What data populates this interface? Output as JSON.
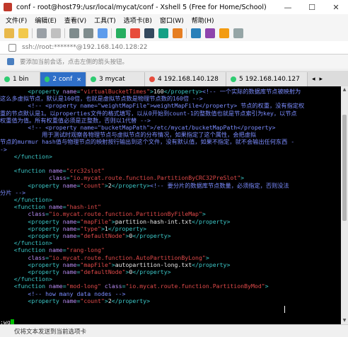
{
  "window": {
    "title": "conf - root@host79:/usr/local/mycat/conf - Xshell 5 (Free for Home/School)",
    "min": "—",
    "max": "☐",
    "close": "✕"
  },
  "menu": [
    "文件(F)",
    "编辑(E)",
    "查看(V)",
    "工具(T)",
    "选项卡(B)",
    "窗口(W)",
    "帮助(H)"
  ],
  "address": "ssh://root:*******@192.168.140.128:22",
  "hint": "要添加当前会话，点击左侧的箭头按钮。",
  "tabs": [
    {
      "label": "1 bin",
      "dot": "#2ecc71"
    },
    {
      "label": "2 conf",
      "dot": "#2ecc71"
    },
    {
      "label": "3 mycat",
      "dot": "#2ecc71"
    },
    {
      "label": "4 192.168.140.128",
      "dot": "#e74c3c"
    },
    {
      "label": "5 192.168.140.127",
      "dot": "#2ecc71"
    }
  ],
  "terminal_lines": [
    [
      [
        "tg",
        "        <"
      ],
      [
        "tg",
        "property "
      ],
      [
        "at",
        "name"
      ],
      [
        "tg",
        "="
      ],
      [
        "st",
        "\"virtualBucketTimes\""
      ],
      [
        "tg",
        ">"
      ],
      [
        "tx",
        "160"
      ],
      [
        "tg",
        "</property>"
      ],
      [
        "cm",
        "<!-- 一个实际的数据库节点被映射为"
      ]
    ],
    [
      [
        "cm",
        "这么多虚拟节点，默认是160倍，也就是虚拟节点数是物理节点数的160倍 -->"
      ]
    ],
    [
      [
        "cm",
        "        <!-- <property name=\"weightMapFile\">weightMapFile</property> 节点的权重，没有指定权"
      ]
    ],
    [
      [
        "cm",
        "重的节点默认是1。以properties文件的格式填写，以从0开始到count-1的整数值也就是节点索引为key，以节点"
      ]
    ],
    [
      [
        "cm",
        "权重值为值。所有权重值必须是正整数，否则以1代替 -->"
      ]
    ],
    [
      [
        "cm",
        "        <!-- <property name=\"bucketMapPath\">/etc/mycat/bucketMapPath</property>"
      ]
    ],
    [
      [
        "cm",
        "            用于测试时观察各物理节点与虚拟节点的分布情况，如果指定了这个属性，会把虚拟"
      ]
    ],
    [
      [
        "cm",
        "节点的murmur hash值与物理节点的映射按行输出到这个文件，没有默认值，如果不指定，就不会输出任何东西 -"
      ]
    ],
    [
      [
        "cm",
        "->"
      ]
    ],
    [
      [
        "tg",
        "    </function>"
      ]
    ],
    [
      [
        "tx",
        ""
      ]
    ],
    [
      [
        "tg",
        "    <function "
      ],
      [
        "at",
        "name"
      ],
      [
        "tg",
        "="
      ],
      [
        "st",
        "\"crc32slot\""
      ]
    ],
    [
      [
        "tg",
        "              "
      ],
      [
        "at",
        "class"
      ],
      [
        "tg",
        "="
      ],
      [
        "st",
        "\"io.mycat.route.function.PartitionByCRC32PreSlot\""
      ],
      [
        "tg",
        ">"
      ]
    ],
    [
      [
        "tg",
        "        <property "
      ],
      [
        "at",
        "name"
      ],
      [
        "tg",
        "="
      ],
      [
        "st",
        "\"count\""
      ],
      [
        "tg",
        ">"
      ],
      [
        "tx",
        "2"
      ],
      [
        "tg",
        "</property>"
      ],
      [
        "cm",
        "<!-- 要分片的数据库节点数量，必须指定，否则没法"
      ]
    ],
    [
      [
        "cm",
        "分片 -->"
      ]
    ],
    [
      [
        "tg",
        "    </function>"
      ]
    ],
    [
      [
        "tg",
        "    <function "
      ],
      [
        "at",
        "name"
      ],
      [
        "tg",
        "="
      ],
      [
        "st",
        "\"hash-int\""
      ]
    ],
    [
      [
        "tg",
        "        "
      ],
      [
        "at",
        "class"
      ],
      [
        "tg",
        "="
      ],
      [
        "st",
        "\"io.mycat.route.function.PartitionByFileMap\""
      ],
      [
        "tg",
        ">"
      ]
    ],
    [
      [
        "tg",
        "        <property "
      ],
      [
        "at",
        "name"
      ],
      [
        "tg",
        "="
      ],
      [
        "st",
        "\"mapFile\""
      ],
      [
        "tg",
        ">"
      ],
      [
        "tx",
        "partition-hash-int.txt"
      ],
      [
        "tg",
        "</property>"
      ]
    ],
    [
      [
        "tg",
        "        <property "
      ],
      [
        "at",
        "name"
      ],
      [
        "tg",
        "="
      ],
      [
        "st",
        "\"type\""
      ],
      [
        "tg",
        ">"
      ],
      [
        "tx",
        "1"
      ],
      [
        "tg",
        "</property>"
      ]
    ],
    [
      [
        "tg",
        "        <property "
      ],
      [
        "at",
        "name"
      ],
      [
        "tg",
        "="
      ],
      [
        "st",
        "\"defaultNode\""
      ],
      [
        "tg",
        ">"
      ],
      [
        "tx",
        "0"
      ],
      [
        "tg",
        "</property>"
      ]
    ],
    [
      [
        "tg",
        "    </function>"
      ]
    ],
    [
      [
        "tg",
        "    <function "
      ],
      [
        "at",
        "name"
      ],
      [
        "tg",
        "="
      ],
      [
        "st",
        "\"rang-long\""
      ]
    ],
    [
      [
        "tg",
        "        "
      ],
      [
        "at",
        "class"
      ],
      [
        "tg",
        "="
      ],
      [
        "st",
        "\"io.mycat.route.function.AutoPartitionByLong\""
      ],
      [
        "tg",
        ">"
      ]
    ],
    [
      [
        "tg",
        "        <property "
      ],
      [
        "at",
        "name"
      ],
      [
        "tg",
        "="
      ],
      [
        "st",
        "\"mapFile\""
      ],
      [
        "tg",
        ">"
      ],
      [
        "tx",
        "autopartition-long.txt"
      ],
      [
        "tg",
        "</property>"
      ]
    ],
    [
      [
        "tg",
        "        <property "
      ],
      [
        "at",
        "name"
      ],
      [
        "tg",
        "="
      ],
      [
        "st",
        "\"defaultNode\""
      ],
      [
        "tg",
        ">"
      ],
      [
        "tx",
        "0"
      ],
      [
        "tg",
        "</property>"
      ]
    ],
    [
      [
        "tg",
        "    </function>"
      ]
    ],
    [
      [
        "tg",
        "    <function "
      ],
      [
        "at",
        "name"
      ],
      [
        "tg",
        "="
      ],
      [
        "st",
        "\"mod-long\""
      ],
      [
        "tg",
        " "
      ],
      [
        "at",
        "class"
      ],
      [
        "tg",
        "="
      ],
      [
        "st",
        "\"io.mycat.route.function.PartitionByMod\""
      ],
      [
        "tg",
        ">"
      ]
    ],
    [
      [
        "cm",
        "        <!-- how many data nodes -->"
      ]
    ],
    [
      [
        "tg",
        "        <property "
      ],
      [
        "at",
        "name"
      ],
      [
        "tg",
        "="
      ],
      [
        "st",
        "\"count\""
      ],
      [
        "tg",
        ">"
      ],
      [
        "tx",
        "2"
      ],
      [
        "tg",
        "</property>"
      ]
    ],
    [
      [
        "tx",
        ""
      ]
    ],
    [
      [
        "tx",
        ""
      ]
    ],
    [
      [
        "tx",
        ":wq"
      ]
    ]
  ],
  "status": "仅将文本发送到当前选项卡",
  "colors": {
    "tag": "#3cc7c7",
    "attr": "#b68af0",
    "string": "#e04a4a",
    "comment": "#7b8cff",
    "active_tab": "#2f6fc8"
  }
}
